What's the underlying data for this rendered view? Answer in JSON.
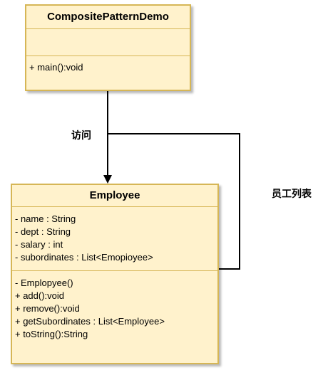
{
  "composite_demo": {
    "name": "CompositePatternDemo",
    "attributes": [],
    "operations": [
      "+ main():void"
    ]
  },
  "employee": {
    "name": "Employee",
    "attributes": [
      "- name : String",
      "- dept : String",
      "- salary : int",
      "- subordinates : List<Emopioyee>"
    ],
    "operations": [
      "- Emplopyee()",
      "+ add():void",
      "+ remove():void",
      "+ getSubordinates : List<Employee>",
      "+ toString():String"
    ]
  },
  "edges": {
    "visit_label": "访问",
    "employee_list_label": "员工列表"
  },
  "colors": {
    "class_fill": "#fff2cc",
    "class_border": "#d6b656",
    "line": "#000000"
  }
}
